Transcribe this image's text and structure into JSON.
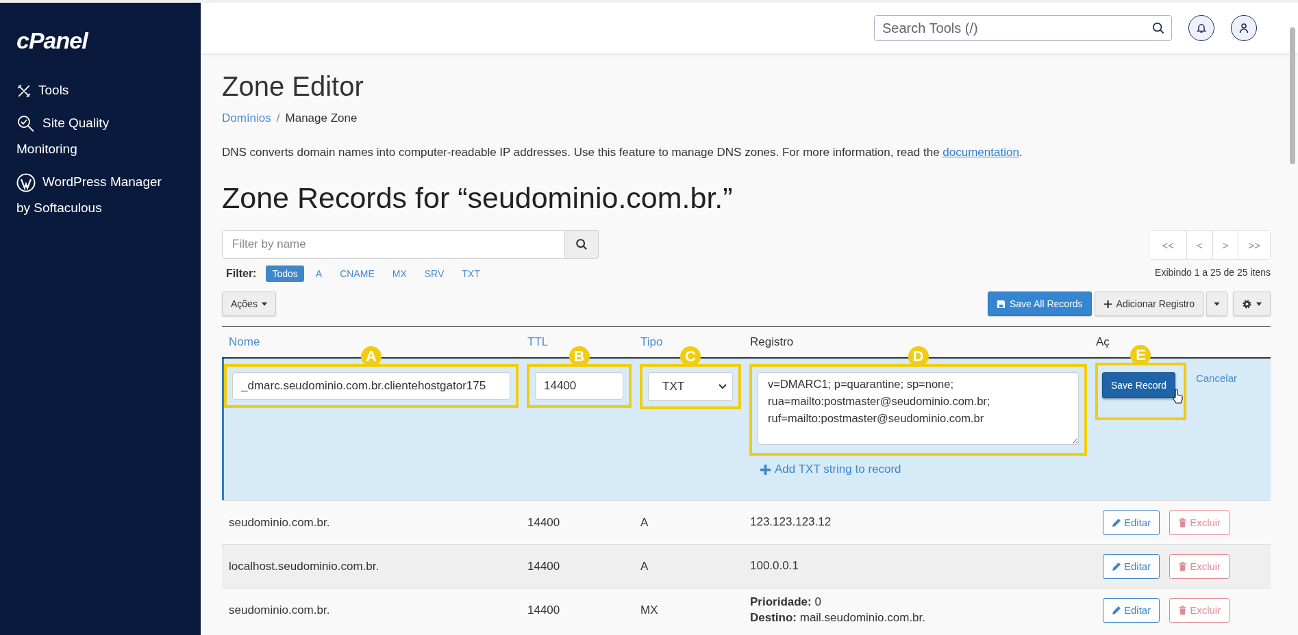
{
  "sidebar": {
    "logo": "cPanel",
    "items": [
      {
        "label": "Tools",
        "kind": "tools"
      },
      {
        "label": "Site Quality Monitoring",
        "kind": "quality"
      },
      {
        "label": "WordPress Manager by Softaculous",
        "kind": "wordpress"
      }
    ]
  },
  "header": {
    "search": {
      "placeholder": "Search Tools (/)"
    }
  },
  "title": "Zone Editor",
  "breadcrumb": [
    {
      "label": "Domínios",
      "kind": "link"
    },
    {
      "label": "Manage Zone",
      "kind": "current"
    }
  ],
  "separator": "/",
  "description": {
    "text": "DNS converts domain names into computer-readable IP addresses. Use this feature to manage DNS zones. For more information, read the ",
    "link": "documentation",
    "end": "."
  },
  "heading": "Zone Records for “seudominio.com.br.”",
  "filter_field": {
    "placeholder": "Filter by name"
  },
  "filter_label": "Filter:",
  "filters": [
    {
      "label": "Todos",
      "selected": true
    },
    {
      "label": "A",
      "selected": false
    },
    {
      "label": "CNAME",
      "selected": false
    },
    {
      "label": "MX",
      "selected": false
    },
    {
      "label": "SRV",
      "selected": false
    },
    {
      "label": "TXT",
      "selected": false
    }
  ],
  "pagination": [
    "<<",
    "<",
    ">",
    ">>"
  ],
  "showing": "Exibindo 1 a 25 de 25 itens",
  "actions_menu": "Ações",
  "save_all": "Save All Records",
  "add_record": "Adicionar Registro",
  "columns": [
    {
      "label": "Nome",
      "sortable": true
    },
    {
      "label": "TTL",
      "sortable": true
    },
    {
      "label": "Tipo",
      "sortable": true
    },
    {
      "label": "Registro",
      "sortable": false
    },
    {
      "label": "Aç",
      "sortable": false
    }
  ],
  "edit_row": {
    "name": {
      "value": "_dmarc.seudominio.com.br.clientehostgator175",
      "callout": "A"
    },
    "ttl": {
      "value": "14400",
      "callout": "B"
    },
    "type": {
      "value": "TXT",
      "callout": "C"
    },
    "record": {
      "value": "v=DMARC1; p=quarantine; sp=none; rua=mailto:postmaster@seudominio.com.br; ruf=mailto:postmaster@seudominio.com.br",
      "callout": "D"
    },
    "add_txt": "Add TXT string to record",
    "save": {
      "label": "Save Record",
      "callout": "E"
    },
    "cancel": "Cancelar"
  },
  "rows": [
    {
      "name": "seudominio.com.br.",
      "ttl": "14400",
      "type": "A",
      "record": [
        "123.123.123.12"
      ],
      "edit": "Editar",
      "delete": "Excluir"
    },
    {
      "name": "localhost.seudominio.com.br.",
      "ttl": "14400",
      "type": "A",
      "record": [
        "100.0.0.1"
      ],
      "edit": "Editar",
      "delete": "Excluir"
    },
    {
      "name": "seudominio.com.br.",
      "ttl": "14400",
      "type": "MX",
      "record": [
        "**Prioridade:** 0",
        "**Destino:** mail.seudominio.com.br."
      ],
      "edit": "Editar",
      "delete": "Excluir"
    }
  ]
}
